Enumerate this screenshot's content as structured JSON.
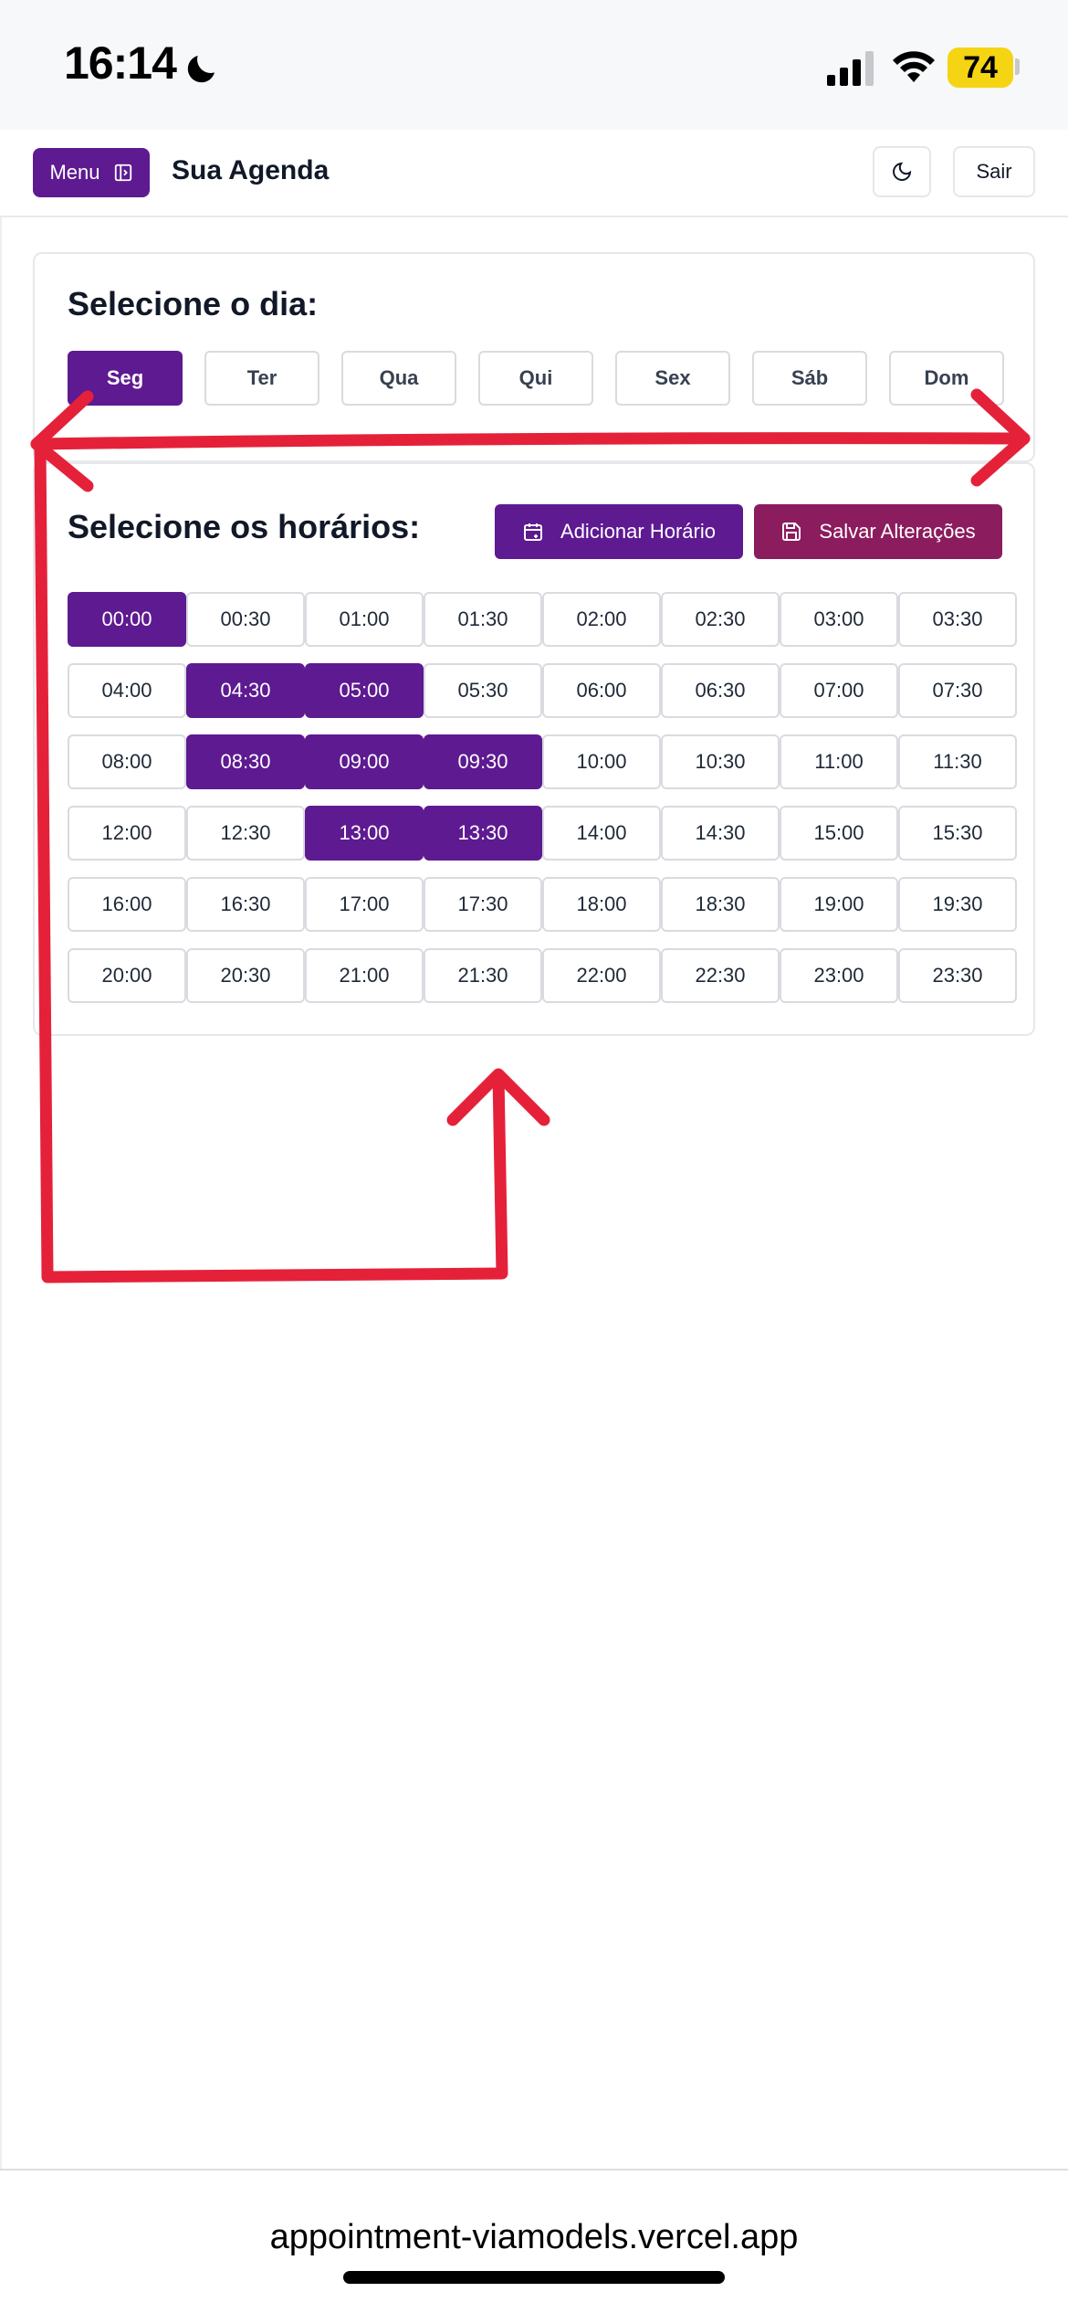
{
  "status_bar": {
    "time": "16:14",
    "battery": "74",
    "icons": [
      "moon-icon",
      "signal-icon",
      "wifi-icon",
      "battery-icon"
    ]
  },
  "header": {
    "menu_label": "Menu",
    "title": "Sua Agenda",
    "logout_label": "Sair"
  },
  "day_selector": {
    "title": "Selecione o dia:",
    "days": [
      "Seg",
      "Ter",
      "Qua",
      "Qui",
      "Sex",
      "Sáb",
      "Dom"
    ],
    "selected": "Seg"
  },
  "hours": {
    "title": "Selecione os horários:",
    "add_label": "Adicionar Horário",
    "save_label": "Salvar Alterações",
    "slots": [
      "00:00",
      "00:30",
      "01:00",
      "01:30",
      "02:00",
      "02:30",
      "03:00",
      "03:30",
      "04:00",
      "04:30",
      "05:00",
      "05:30",
      "06:00",
      "06:30",
      "07:00",
      "07:30",
      "08:00",
      "08:30",
      "09:00",
      "09:30",
      "10:00",
      "10:30",
      "11:00",
      "11:30",
      "12:00",
      "12:30",
      "13:00",
      "13:30",
      "14:00",
      "14:30",
      "15:00",
      "15:30",
      "16:00",
      "16:30",
      "17:00",
      "17:30",
      "18:00",
      "18:30",
      "19:00",
      "19:30",
      "20:00",
      "20:30",
      "21:00",
      "21:30",
      "22:00",
      "22:30",
      "23:00",
      "23:30"
    ],
    "selected": [
      "00:00",
      "04:30",
      "05:00",
      "08:30",
      "09:00",
      "09:30",
      "13:00",
      "13:30"
    ]
  },
  "browser": {
    "url": "appointment-viamodels.vercel.app"
  },
  "colors": {
    "primary": "#5e1a91",
    "save": "#8b1c5e",
    "annotation": "#e5213a",
    "battery": "#f5d414"
  }
}
